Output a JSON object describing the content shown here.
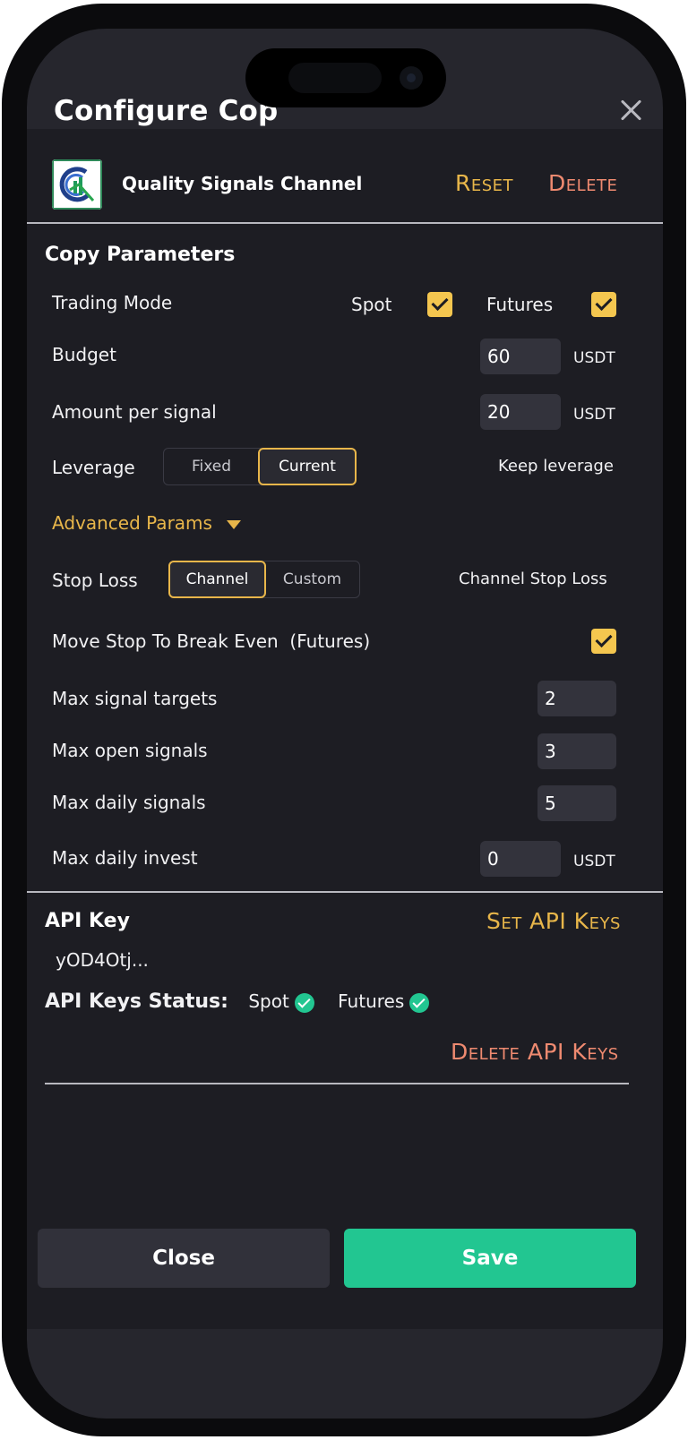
{
  "modal": {
    "title": "Configure Cop"
  },
  "channel": {
    "name": "Quality Signals Channel",
    "reset_label": "Reset",
    "delete_label": "Delete"
  },
  "copy_parameters": {
    "title": "Copy Parameters",
    "trading_mode": {
      "label": "Trading Mode",
      "spot_label": "Spot",
      "spot_checked": true,
      "futures_label": "Futures",
      "futures_checked": true
    },
    "budget": {
      "label": "Budget",
      "value": "60",
      "unit": "USDT"
    },
    "amount_per_signal": {
      "label": "Amount per signal",
      "value": "20",
      "unit": "USDT"
    },
    "leverage": {
      "label": "Leverage",
      "options": [
        "Fixed",
        "Current"
      ],
      "selected": "Current",
      "description": "Keep leverage"
    },
    "advanced_label": "Advanced Params",
    "stop_loss": {
      "label": "Stop Loss",
      "options": [
        "Channel",
        "Custom"
      ],
      "selected": "Channel",
      "description": "Channel Stop Loss"
    },
    "move_stop": {
      "label": "Move Stop To Break Even  (Futures)",
      "checked": true
    },
    "max_signal_targets": {
      "label": "Max signal targets",
      "value": "2"
    },
    "max_open_signals": {
      "label": "Max open signals",
      "value": "3"
    },
    "max_daily_signals": {
      "label": "Max daily signals",
      "value": "5"
    },
    "max_daily_invest": {
      "label": "Max daily invest",
      "value": "0",
      "unit": "USDT"
    }
  },
  "api": {
    "title": "API Key",
    "set_keys_label": "Set API Keys",
    "key_value": "yOD4Otj...",
    "status_label": "API Keys Status:",
    "spot_label": "Spot",
    "futures_label": "Futures",
    "delete_keys_label": "Delete API Keys"
  },
  "footer": {
    "close_label": "Close",
    "save_label": "Save"
  },
  "colors": {
    "accent": "#e8b64a",
    "danger": "#ef8a70",
    "success": "#22c691",
    "background": "#26262d",
    "card": "#1d1d23"
  },
  "icons": [
    "close-icon",
    "channel-logo",
    "checkbox-check-icon",
    "caret-down-icon",
    "status-check-icon"
  ]
}
